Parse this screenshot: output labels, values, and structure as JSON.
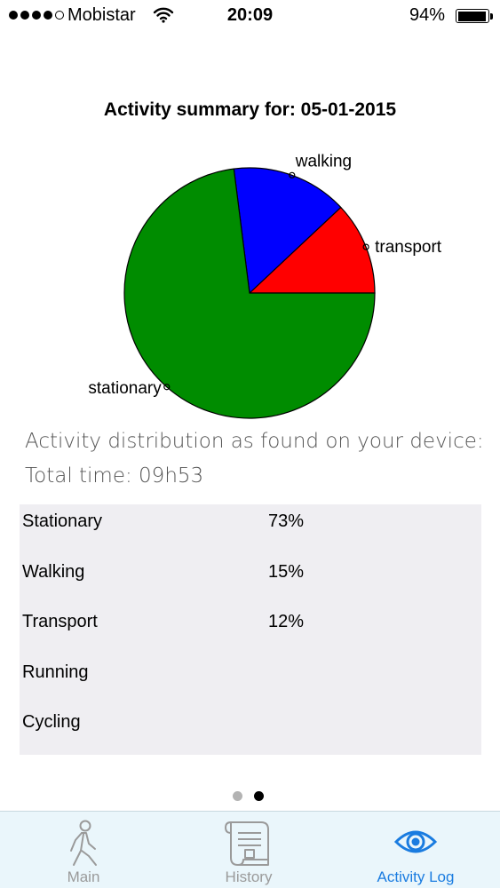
{
  "status_bar": {
    "carrier": "Mobistar",
    "time": "20:09",
    "battery_percent": "94%",
    "battery_level": 0.94,
    "signal_bars_filled": 4,
    "signal_bars_total": 5
  },
  "chart": {
    "title": "Activity summary for: 05-01-2015"
  },
  "chart_data": {
    "type": "pie",
    "title": "Activity summary for: 05-01-2015",
    "slices": [
      {
        "label": "transport",
        "value": 12,
        "color": "#ff0000"
      },
      {
        "label": "walking",
        "value": 15,
        "color": "#0000ff"
      },
      {
        "label": "stationary",
        "value": 73,
        "color": "#008c00"
      }
    ]
  },
  "summary": {
    "distribution_text": "Activity distribution as found on your device:",
    "total_time": "Total time: 09h53"
  },
  "activities": [
    {
      "name": "Stationary",
      "percent": "73%"
    },
    {
      "name": "Walking",
      "percent": "15%"
    },
    {
      "name": "Transport",
      "percent": "12%"
    },
    {
      "name": "Running",
      "percent": ""
    },
    {
      "name": "Cycling",
      "percent": ""
    }
  ],
  "pager": {
    "page_count": 2,
    "current_page": 2
  },
  "tabs": [
    {
      "label": "Main",
      "icon": "walking-person-icon",
      "selected": false
    },
    {
      "label": "History",
      "icon": "scroll-icon",
      "selected": false
    },
    {
      "label": "Activity Log",
      "icon": "eye-icon",
      "selected": true
    }
  ],
  "colors": {
    "tab_selected": "#1a7ce0",
    "tab_unselected": "#9a9a9a",
    "tab_bar_bg": "#eaf6fb",
    "table_bg": "#efeef2"
  }
}
